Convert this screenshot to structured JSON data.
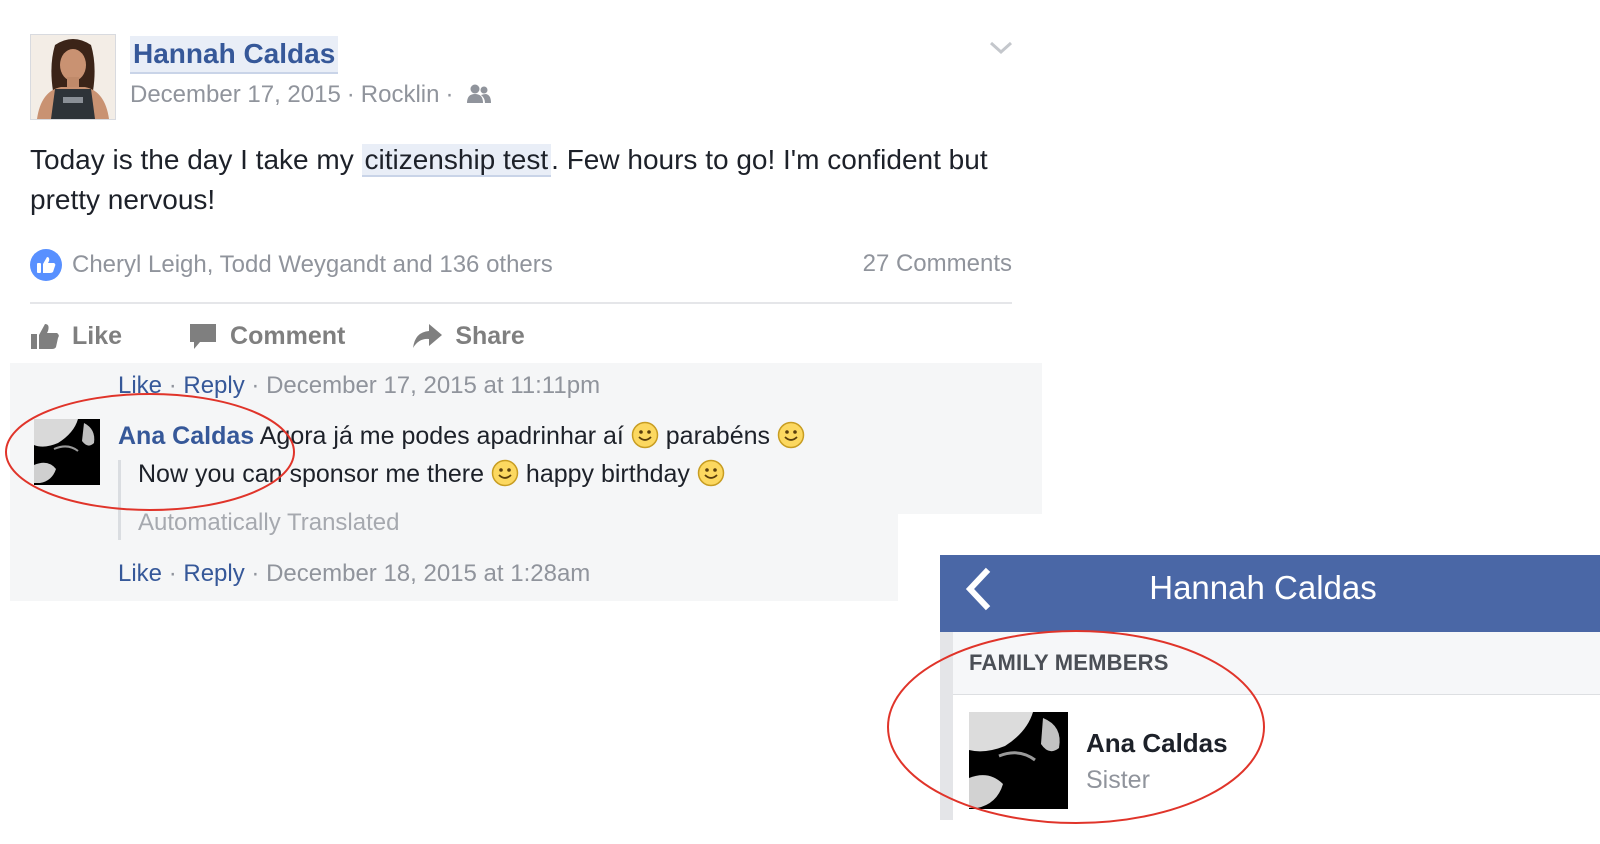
{
  "post": {
    "author": "Hannah Caldas",
    "date": "December 17, 2015",
    "location": "Rocklin",
    "meta_separator": "·",
    "audience_icon": "friends-icon",
    "menu_icon": "chevron-down-icon",
    "text_before": "Today is the day I take my ",
    "text_highlight": "citizenship test",
    "text_after": ". Few hours to go! I'm confident but pretty nervous!",
    "reactions_text": "Cheryl Leigh, Todd Weygandt and 136 others",
    "comments_count": "27 Comments",
    "actions": {
      "like": "Like",
      "comment": "Comment",
      "share": "Share"
    }
  },
  "comments": {
    "prev_meta": {
      "like": "Like",
      "sep": "·",
      "reply": "Reply",
      "timestamp": "December 17, 2015 at 11:11pm"
    },
    "comment": {
      "author": "Ana Caldas",
      "text_part1": "Agora já me podes apadrinhar aí ",
      "text_part2": " parabéns ",
      "translation_part1": "Now you can sponsor me there ",
      "translation_part2": " happy birthday ",
      "auto_translated": "Automatically Translated",
      "like": "Like",
      "sep": "·",
      "reply": "Reply",
      "timestamp": "December 18, 2015 at 1:28am"
    }
  },
  "mobile": {
    "title": "Hannah Caldas",
    "back_icon": "chevron-left-icon",
    "section": "FAMILY MEMBERS",
    "member": {
      "name": "Ana Caldas",
      "relation": "Sister"
    }
  },
  "colors": {
    "link": "#365899",
    "meta": "#90949c",
    "mobile_header": "#4a67a6",
    "annotation": "#e0342a"
  }
}
